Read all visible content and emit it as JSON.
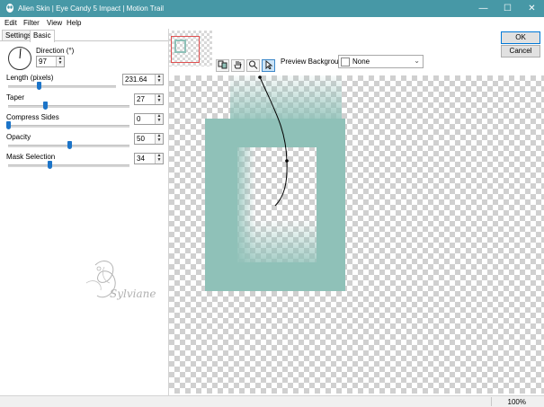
{
  "window": {
    "title": "Alien Skin | Eye Candy 5 Impact | Motion Trail",
    "minimize_glyph": "—",
    "maximize_glyph": "☐",
    "close_glyph": "✕"
  },
  "menu": [
    "Edit",
    "Filter",
    "View",
    "Help"
  ],
  "tabs": [
    {
      "label": "Settings",
      "active": false
    },
    {
      "label": "Basic",
      "active": true
    }
  ],
  "params": {
    "direction": {
      "label": "Direction (°)",
      "value": "97"
    },
    "length": {
      "label": "Length (pixels)",
      "value": "231.64",
      "level": 0.28
    },
    "taper": {
      "label": "Taper",
      "value": "27",
      "level": 0.3
    },
    "compress": {
      "label": "Compress Sides",
      "value": "0",
      "level": 0.0
    },
    "opacity": {
      "label": "Opacity",
      "value": "50",
      "level": 0.5
    },
    "mask": {
      "label": "Mask Selection",
      "value": "34",
      "level": 0.34
    }
  },
  "preview": {
    "background_label": "Preview Background:",
    "background_value": "None",
    "tools": [
      "preview-zoom-icon",
      "hand-icon",
      "magnifier-icon",
      "arrow-pointer-icon"
    ]
  },
  "buttons": {
    "ok": "OK",
    "cancel": "Cancel"
  },
  "watermark_text": "Sylviane",
  "status": {
    "zoom": "100%"
  },
  "colors": {
    "titlebar": "#4798a6",
    "shape": "#8fc1b8",
    "accent": "#1c74c8"
  }
}
